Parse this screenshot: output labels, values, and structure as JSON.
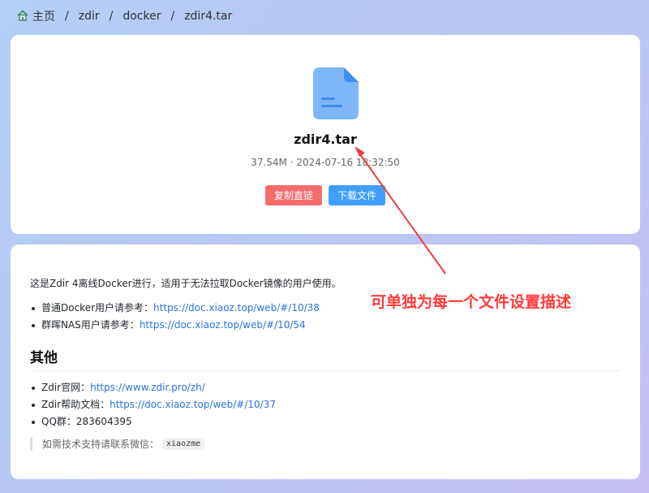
{
  "breadcrumb": {
    "home": "主页",
    "items": [
      "zdir",
      "docker",
      "zdir4.tar"
    ],
    "separator": "/"
  },
  "file": {
    "icon": "document-icon",
    "name": "zdir4.tar",
    "size": "37.54M",
    "meta": "37.54M · 2024-07-16 18:32:50",
    "copy_button": "复制直链",
    "download_button": "下载文件"
  },
  "description": {
    "intro": "这是Zdir 4离线Docker进行，适用于无法拉取Docker镜像的用户使用。",
    "refs": [
      {
        "label": "普通Docker用户请参考：",
        "link": "https://doc.xiaoz.top/web/#/10/38"
      },
      {
        "label": "群晖NAS用户请参考：",
        "link": "https://doc.xiaoz.top/web/#/10/54"
      }
    ],
    "heading": "其他",
    "others": [
      {
        "label": "Zdir官网：",
        "link": "https://www.zdir.pro/zh/"
      },
      {
        "label": "Zdir帮助文档：",
        "link": "https://doc.xiaoz.top/web/#/10/37"
      },
      {
        "label": "QQ群：283604395",
        "link": ""
      }
    ],
    "quote_text": "如需技术支持请联系微信：",
    "quote_code": "xiaozme"
  },
  "annotation": {
    "text": "可单独为每一个文件设置描述",
    "color": "#ff3b3b"
  },
  "colors": {
    "copy": "#f56c6c",
    "download": "#409eff",
    "link": "#2a74d8",
    "file_icon": "#7fb6f8"
  }
}
